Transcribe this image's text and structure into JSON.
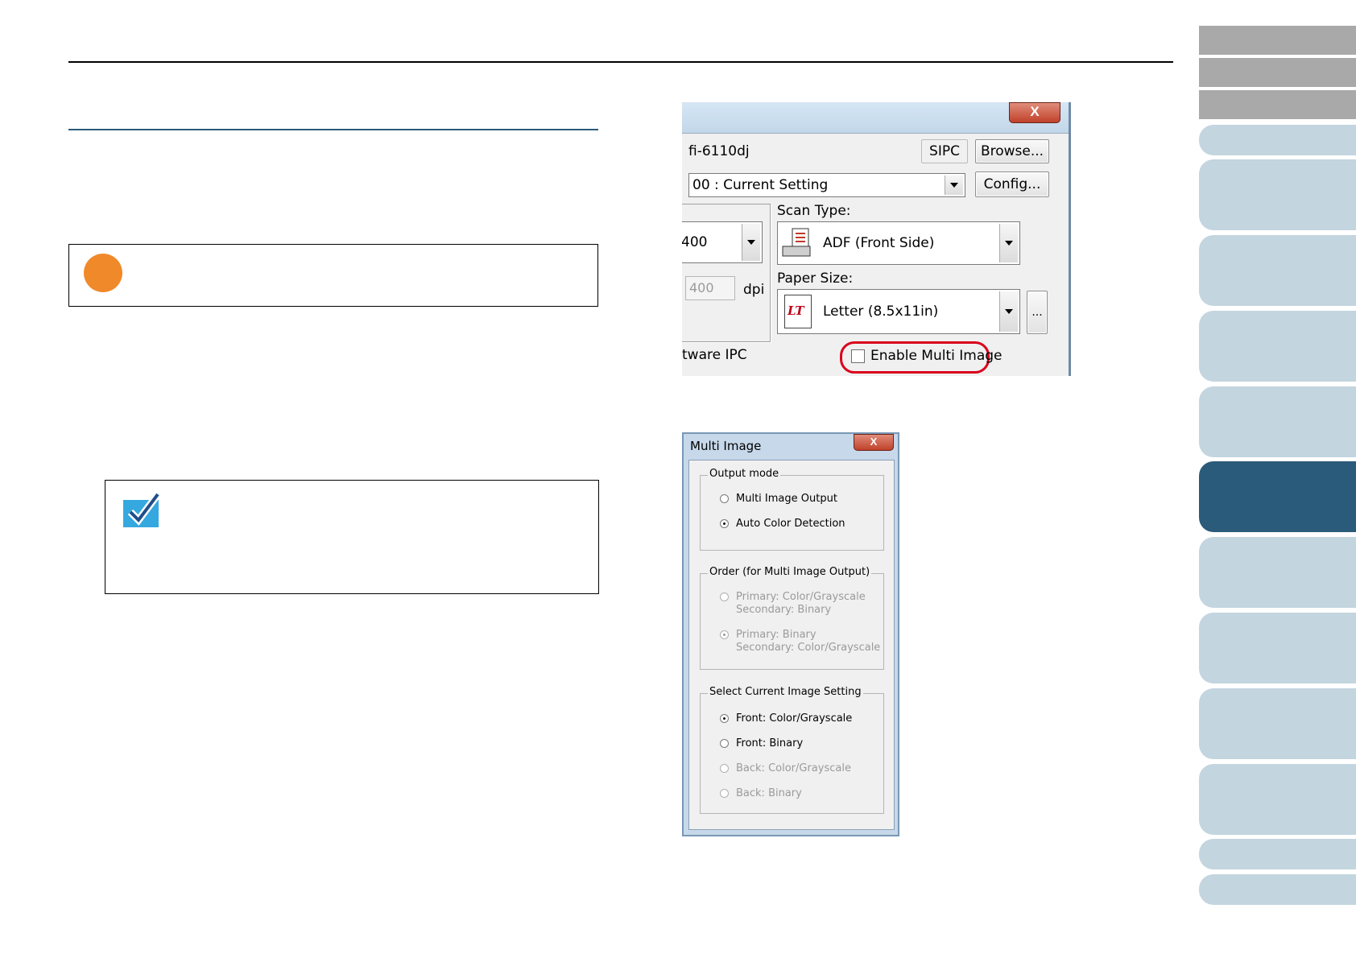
{
  "shot1": {
    "close_label": "X",
    "scanner_name": "fi-6110dj",
    "driver_name": "SIPC",
    "browse_label": "Browse...",
    "setting_value": "00 : Current Setting",
    "config_label": "Config...",
    "resolution_value": "400",
    "custom_resolution_value": "400",
    "dpi_label": "dpi",
    "scan_type_label": "Scan Type:",
    "scan_type_value": "ADF (Front Side)",
    "paper_size_label": "Paper Size:",
    "paper_size_value": "Letter (8.5x11in)",
    "paper_icon_text": "LT",
    "more_label": "...",
    "ipc_label": "tware IPC",
    "multi_image_checkbox": "Enable Multi Image",
    "highlight_color": "#d9001b"
  },
  "shot2": {
    "title": "Multi Image",
    "close_label": "X",
    "output_mode": {
      "legend": "Output mode",
      "options": [
        "Multi Image Output",
        "Auto Color Detection"
      ]
    },
    "order": {
      "legend": "Order (for Multi Image Output)",
      "options": [
        [
          "Primary: Color/Grayscale",
          "Secondary: Binary"
        ],
        [
          "Primary: Binary",
          "Secondary: Color/Grayscale"
        ]
      ]
    },
    "select_current": {
      "legend": "Select Current Image Setting",
      "options": [
        "Front: Color/Grayscale",
        "Front: Binary",
        "Back: Color/Grayscale",
        "Back: Binary"
      ]
    }
  },
  "colors": {
    "accent": "#2a5b7a",
    "attention": "#f0892a",
    "tab_light": "#c3d5df",
    "tab_gray": "#a9a9a9"
  },
  "icons": {
    "attention": "attention-dot-icon",
    "hint": "checkmark-hint-icon"
  }
}
